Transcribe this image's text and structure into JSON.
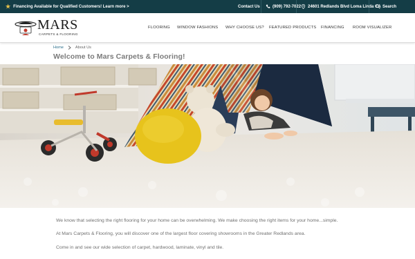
{
  "topbar": {
    "promo": "Financing Available for Qualified Customers! Learn more >",
    "contact": "Contact Us",
    "phone": "(909) 792-7022",
    "address": "24601 Redlands Blvd Loma Linda CA",
    "search": "Search"
  },
  "logo": {
    "name": "MARS",
    "tagline": "CARPETS & FLOORING"
  },
  "nav": {
    "items": [
      "FLOORING",
      "WINDOW FASHIONS",
      "WHY CHOOSE US?",
      "FEATURED PRODUCTS",
      "FINANCING",
      "ROOM VISUALIZER"
    ]
  },
  "breadcrumb": {
    "home": "Home",
    "current": "About Us"
  },
  "page": {
    "title": "Welcome to Mars Carpets & Flooring!",
    "paragraphs": [
      "We know that selecting the right flooring for your home can be overwhelming. We make choosing the right items for your home...simple.",
      "At Mars Carpets & Flooring, you will discover one of the largest floor covering showrooms in the Greater Redlands area.",
      "Come in and see our wide selection of carpet, hardwood, laminate, vinyl and tile."
    ]
  },
  "colors": {
    "topbar_bg": "#143d46",
    "accent_link": "#2a6e8a",
    "star": "#e8c14a"
  }
}
